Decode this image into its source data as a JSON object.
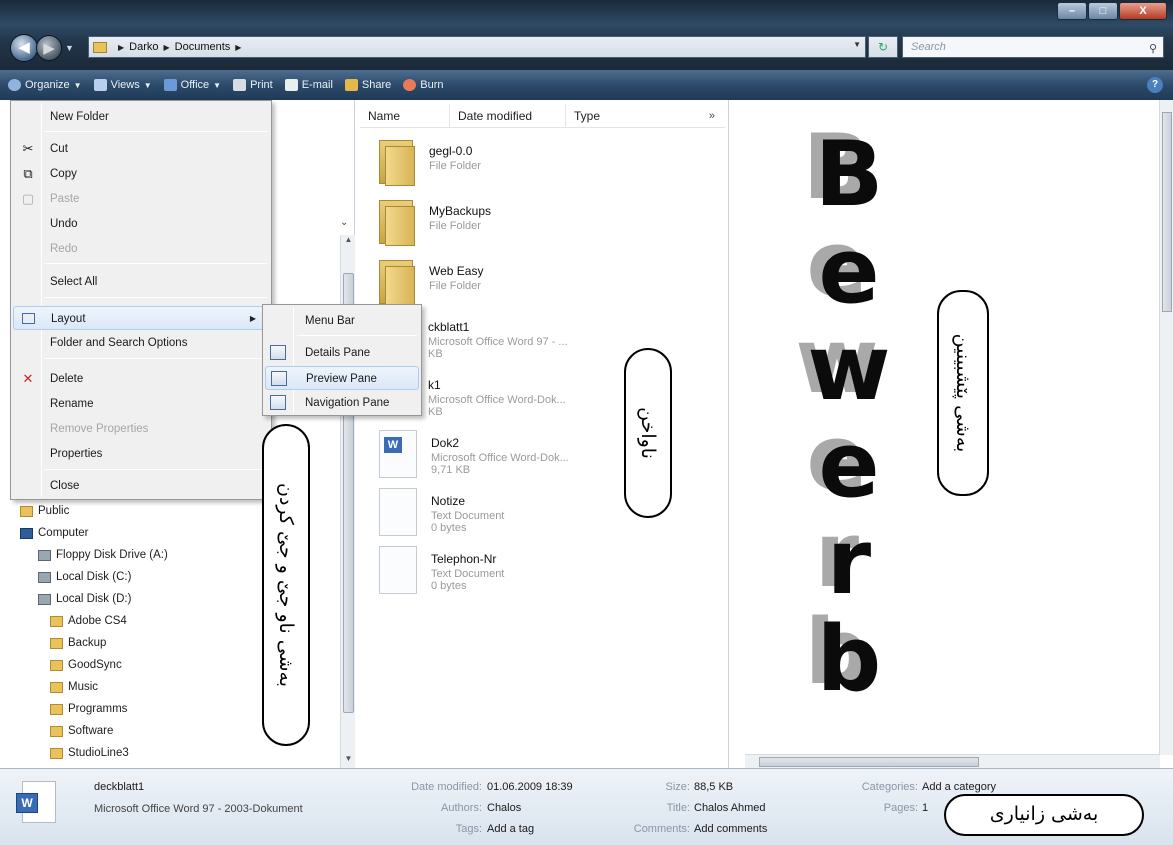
{
  "window": {
    "controls": {
      "minimize": "–",
      "maximize": "□",
      "close": "X"
    }
  },
  "address": {
    "crumbs": [
      "Darko",
      "Documents"
    ],
    "search_placeholder": "Search"
  },
  "commandbar": {
    "items": [
      {
        "label": "Organize",
        "icon": "organize-icon",
        "has_dropdown": true
      },
      {
        "label": "Views",
        "icon": "views-icon",
        "has_dropdown": true
      },
      {
        "label": "Office",
        "icon": "office-icon",
        "has_dropdown": true
      },
      {
        "label": "Print",
        "icon": "printer-icon",
        "has_dropdown": false
      },
      {
        "label": "E-mail",
        "icon": "email-icon",
        "has_dropdown": false
      },
      {
        "label": "Share",
        "icon": "share-icon",
        "has_dropdown": false
      },
      {
        "label": "Burn",
        "icon": "burn-icon",
        "has_dropdown": false
      }
    ]
  },
  "organize_menu": {
    "items": [
      {
        "label": "New Folder",
        "enabled": true
      },
      {
        "label": "Cut",
        "enabled": true,
        "icon": "scissors-icon"
      },
      {
        "label": "Copy",
        "enabled": true,
        "icon": "copy-icon"
      },
      {
        "label": "Paste",
        "enabled": false,
        "icon": "paste-icon"
      },
      {
        "label": "Undo",
        "enabled": true
      },
      {
        "label": "Redo",
        "enabled": false
      },
      {
        "label": "Select All",
        "enabled": true
      },
      {
        "label": "Layout",
        "enabled": true,
        "icon": "layout-icon",
        "submenu": true,
        "highlighted": true
      },
      {
        "label": "Folder and Search Options",
        "enabled": true
      },
      {
        "label": "Delete",
        "enabled": true,
        "icon": "delete-icon"
      },
      {
        "label": "Rename",
        "enabled": true
      },
      {
        "label": "Remove Properties",
        "enabled": false
      },
      {
        "label": "Properties",
        "enabled": true
      },
      {
        "label": "Close",
        "enabled": true
      }
    ]
  },
  "layout_menu": {
    "items": [
      {
        "label": "Menu Bar"
      },
      {
        "label": "Details Pane"
      },
      {
        "label": "Preview Pane",
        "highlighted": true
      },
      {
        "label": "Navigation Pane"
      }
    ]
  },
  "nav_tree": {
    "items": [
      {
        "label": "Public",
        "kind": "folder"
      },
      {
        "label": "Computer",
        "kind": "computer"
      },
      {
        "label": "Floppy Disk Drive (A:)",
        "kind": "disk"
      },
      {
        "label": "Local Disk (C:)",
        "kind": "disk"
      },
      {
        "label": "Local Disk (D:)",
        "kind": "disk"
      },
      {
        "label": "Adobe CS4",
        "kind": "folder"
      },
      {
        "label": "Backup",
        "kind": "folder"
      },
      {
        "label": "GoodSync",
        "kind": "folder"
      },
      {
        "label": "Music",
        "kind": "folder"
      },
      {
        "label": "Programms",
        "kind": "folder"
      },
      {
        "label": "Software",
        "kind": "folder"
      },
      {
        "label": "StudioLine3",
        "kind": "folder"
      }
    ]
  },
  "file_list": {
    "columns": [
      "Name",
      "Date modified",
      "Type"
    ],
    "more": "»",
    "files": [
      {
        "name": "gegl-0.0",
        "type": "File Folder",
        "size": "",
        "kind": "folder"
      },
      {
        "name": "MyBackups",
        "type": "File Folder",
        "size": "",
        "kind": "folder"
      },
      {
        "name": "Web Easy",
        "type": "File Folder",
        "size": "",
        "kind": "folder"
      },
      {
        "name": "ckblatt1",
        "type": "Microsoft Office Word 97 - ...",
        "size": "KB",
        "kind": "word"
      },
      {
        "name": "k1",
        "type": "Microsoft Office Word-Dok...",
        "size": "KB",
        "kind": "word"
      },
      {
        "name": "Dok2",
        "type": "Microsoft Office Word-Dok...",
        "size": "9,71 KB",
        "kind": "word"
      },
      {
        "name": "Notize",
        "type": "Text Document",
        "size": "0 bytes",
        "kind": "text"
      },
      {
        "name": "Telephon-Nr",
        "type": "Text Document",
        "size": "0 bytes",
        "kind": "text"
      }
    ]
  },
  "preview": {
    "letters": [
      "B",
      "e",
      "w",
      "e",
      "r",
      "b"
    ]
  },
  "details": {
    "filename": "deckblatt1",
    "filetype": "Microsoft Office Word 97 - 2003-Dokument",
    "fields": [
      {
        "label": "Date modified:",
        "value": "01.06.2009 18:39"
      },
      {
        "label": "Authors:",
        "value": "Chalos"
      },
      {
        "label": "Tags:",
        "value": "Add a tag"
      },
      {
        "label": "Size:",
        "value": "88,5 KB"
      },
      {
        "label": "Title:",
        "value": "Chalos Ahmed"
      },
      {
        "label": "Comments:",
        "value": "Add comments"
      },
      {
        "label": "Categories:",
        "value": "Add a category"
      },
      {
        "label": "Pages:",
        "value": "1"
      }
    ]
  },
  "annotations": {
    "nav_pane": "بەشی ناو جێ و جێ کردن",
    "files": "ناواخن",
    "preview_pane": "بەشی پێشبینین",
    "details_pane": "بەشی زانیاری"
  },
  "colors": {
    "title_bar": "#223549",
    "command_bar": "#2c4a6a",
    "menu_bg": "#f0f0f0",
    "highlight": "#dbe8f8",
    "word_blue": "#3a6bb5",
    "folder_yellow": "#e8c25a"
  }
}
